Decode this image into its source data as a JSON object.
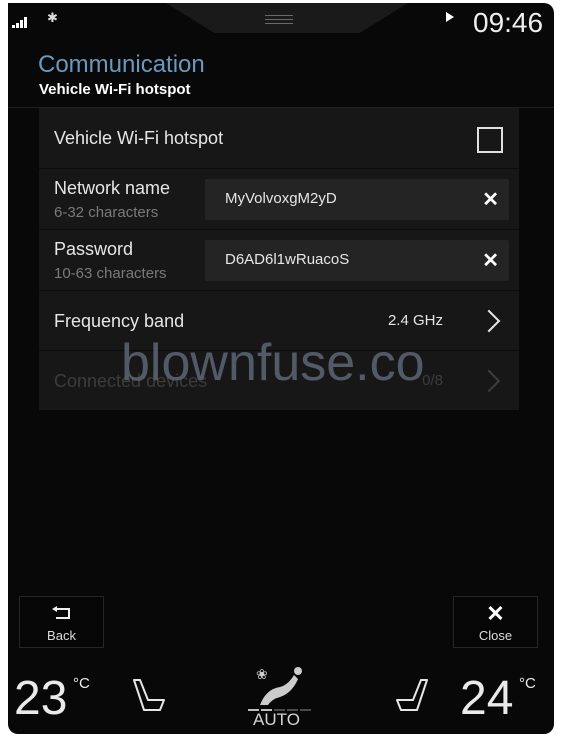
{
  "status_bar": {
    "signal_icon": "cellular-signal-icon",
    "signal_bars_active": 4,
    "bluetooth_icon": "bluetooth-icon",
    "media_icon": "play-icon",
    "time": "09:46"
  },
  "header": {
    "parent": "Communication",
    "title": "Vehicle Wi-Fi hotspot"
  },
  "settings": {
    "hotspot": {
      "label": "Vehicle Wi-Fi hotspot",
      "checked": false
    },
    "network_name": {
      "label": "Network name",
      "hint": "6-32 characters",
      "value": "MyVolvoxgM2yD",
      "clear_glyph": "✕"
    },
    "password": {
      "label": "Password",
      "hint": "10-63 characters",
      "value": "D6AD6l1wRuacoS",
      "clear_glyph": "✕"
    },
    "frequency_band": {
      "label": "Frequency band",
      "value": "2.4 GHz"
    },
    "connected_devices": {
      "label": "Connected devices",
      "value": "0/8",
      "enabled": false
    }
  },
  "watermark": "blownfuse.co",
  "footer": {
    "back": {
      "label": "Back",
      "icon": "back-arrow-icon"
    },
    "close": {
      "label": "Close",
      "icon": "close-icon",
      "glyph": "✕"
    }
  },
  "climate": {
    "left_temp": "23",
    "right_temp": "24",
    "unit": "°C",
    "left_seat_icon": "seat-heat-left-icon",
    "right_seat_icon": "seat-heat-right-icon",
    "fan_mode": "AUTO",
    "fan_level": 2,
    "fan_level_max": 5
  },
  "colors": {
    "accent": "#6a99bf",
    "background": "#080808",
    "panel": "#171717"
  }
}
